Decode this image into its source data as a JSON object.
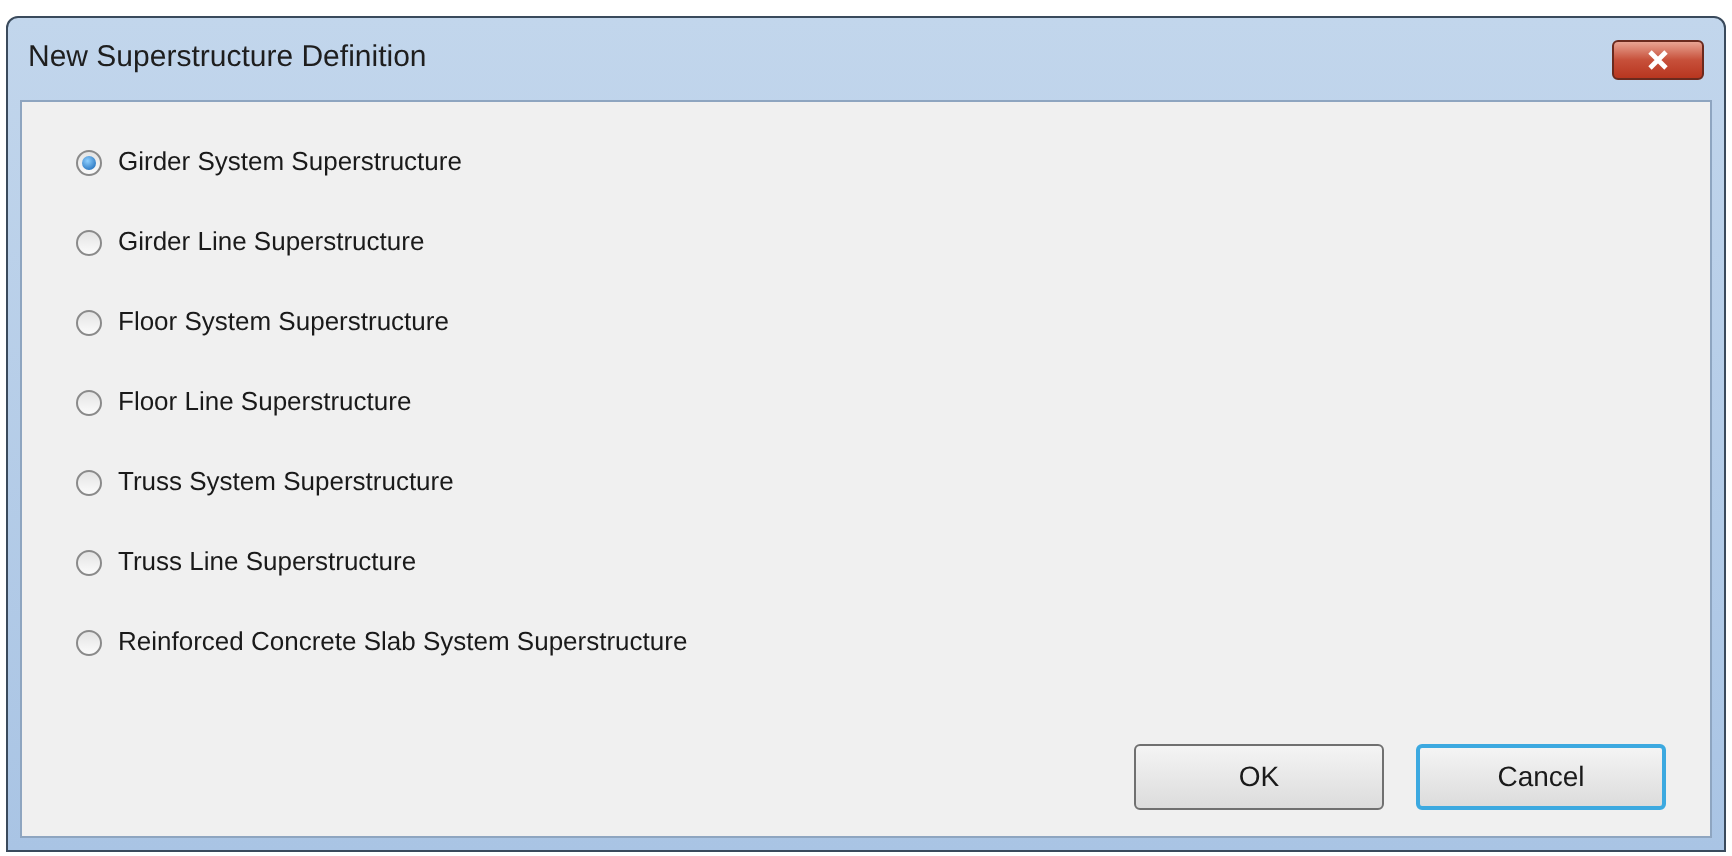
{
  "window": {
    "title": "New Superstructure Definition"
  },
  "options": [
    {
      "label": "Girder System Superstructure",
      "selected": true
    },
    {
      "label": "Girder Line Superstructure",
      "selected": false
    },
    {
      "label": "Floor System Superstructure",
      "selected": false
    },
    {
      "label": "Floor Line Superstructure",
      "selected": false
    },
    {
      "label": "Truss System Superstructure",
      "selected": false
    },
    {
      "label": "Truss Line Superstructure",
      "selected": false
    },
    {
      "label": "Reinforced Concrete Slab System Superstructure",
      "selected": false
    }
  ],
  "buttons": [
    {
      "label": "OK",
      "focused": false
    },
    {
      "label": "Cancel",
      "focused": true
    }
  ]
}
